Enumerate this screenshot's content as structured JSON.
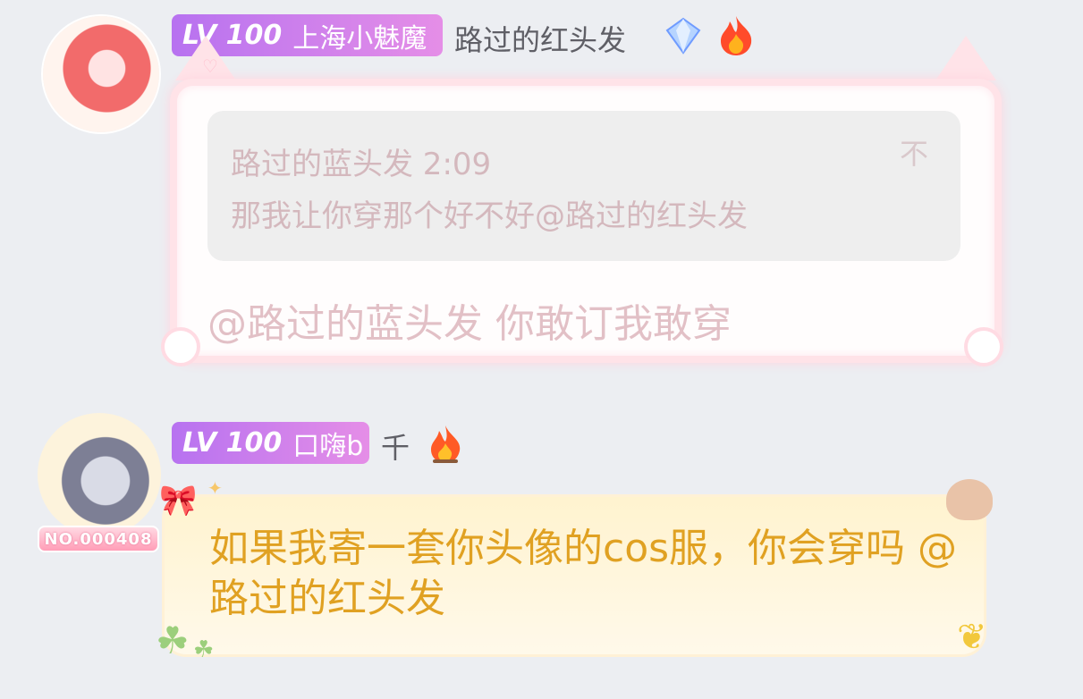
{
  "messages": [
    {
      "level": "LV 100",
      "title": "上海小魅魔",
      "username": "路过的红头发",
      "icons": [
        "avatar-red-hair",
        "diamond-icon",
        "fire-icon"
      ],
      "quote": {
        "author": "路过的蓝头发 2:09",
        "text": "那我让你穿那个好不好@路过的红头发",
        "pin_icon": "不"
      },
      "text": "@路过的蓝头发 你敢订我敢穿"
    },
    {
      "level": "LV 100",
      "title": "口嗨b",
      "username": "千",
      "avatar_badge": "NO.000408",
      "icons": [
        "avatar-silver-hair",
        "fire-icon"
      ],
      "text": "如果我寄一套你头像的cos服，你会穿吗 @路过的红头发"
    }
  ],
  "colors": {
    "background": "#eceef2",
    "level_badge": "#c27cf0",
    "bubble1_text": "#e2c0c6",
    "bubble2_text": "#e0a122"
  }
}
